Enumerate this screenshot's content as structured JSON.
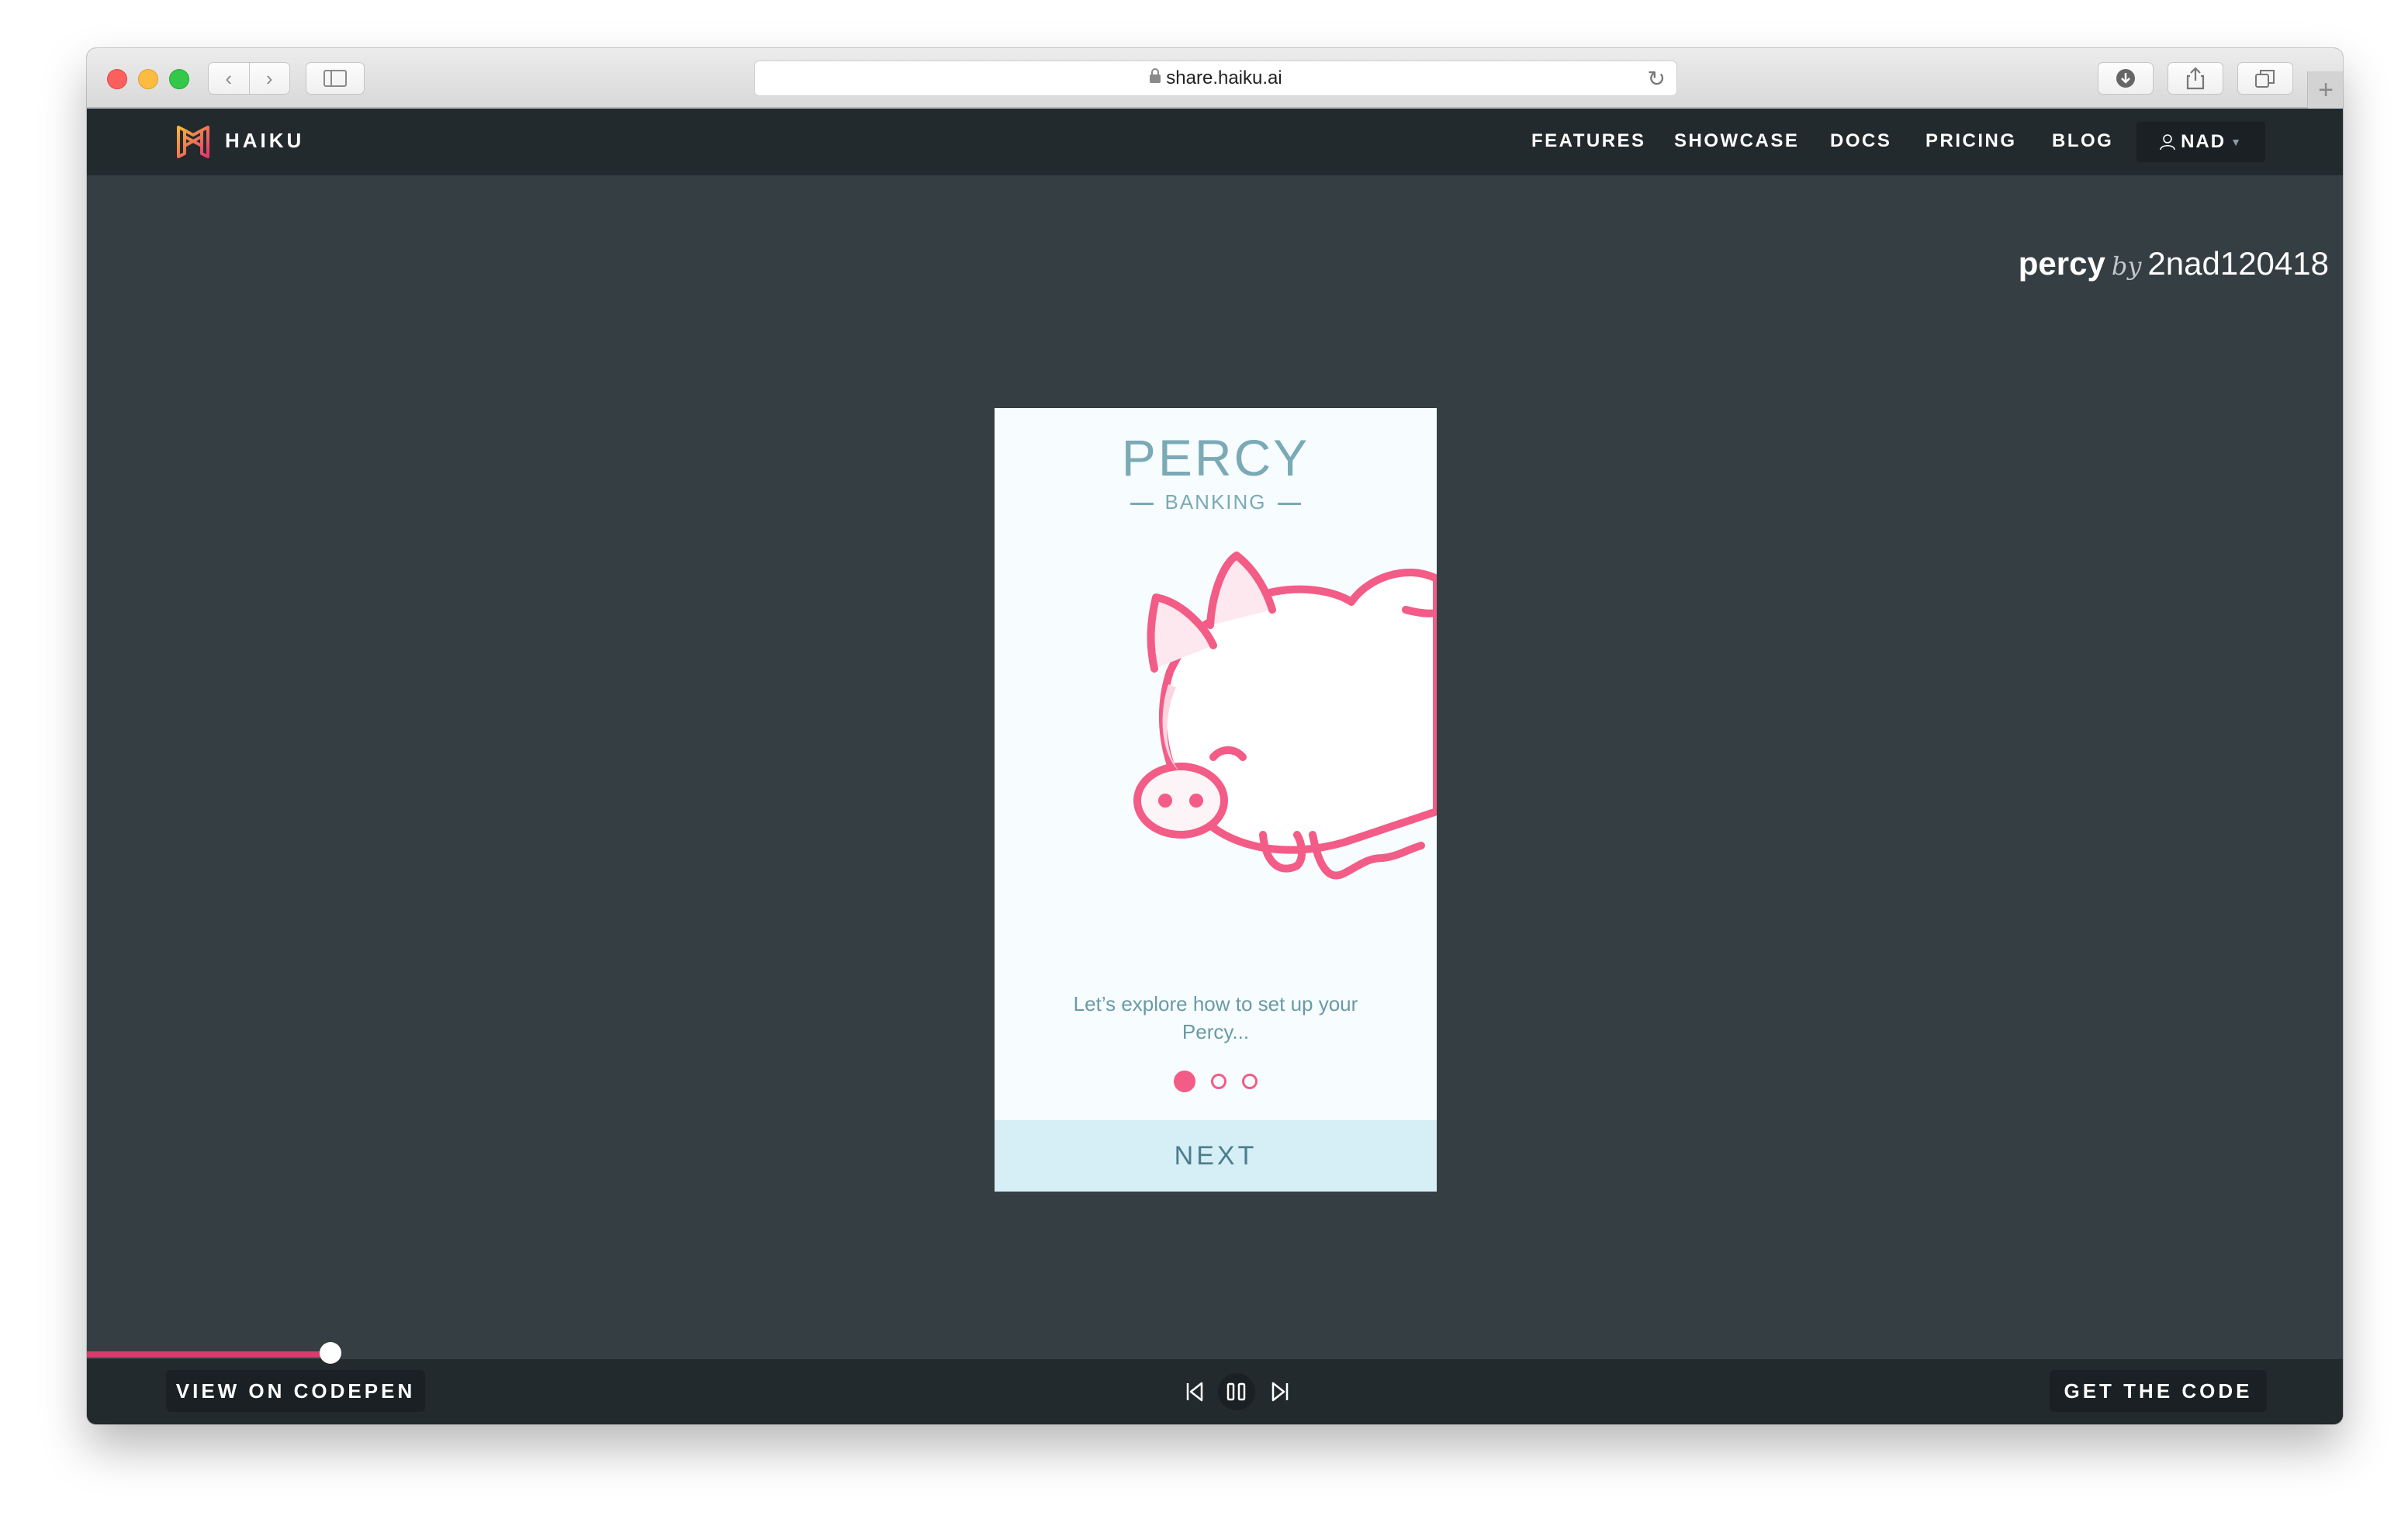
{
  "browser": {
    "url": "share.haiku.ai",
    "icons": {
      "back": "chevron-left-icon",
      "forward": "chevron-right-icon",
      "sidebar": "sidebar-icon",
      "lock": "lock-icon",
      "reload": "reload-icon",
      "download": "download-icon",
      "share": "share-icon",
      "tabs": "tabs-icon",
      "new_tab": "plus-icon"
    }
  },
  "header": {
    "brand": "HAIKU",
    "nav": [
      "FEATURES",
      "SHOWCASE",
      "DOCS",
      "PRICING",
      "BLOG"
    ],
    "user": "NAD"
  },
  "credit": {
    "project": "percy",
    "by": "by",
    "author": "2nad120418"
  },
  "phone": {
    "title": "PERCY",
    "subtitle": "BANKING",
    "text_line1": "Let’s explore how to set up your",
    "text_line2": "Percy...",
    "pages": 3,
    "active_page": 1,
    "next_label": "NEXT"
  },
  "player": {
    "progress": 0.075,
    "codepen_label": "VIEW ON CODEPEN",
    "code_label": "GET THE CODE"
  },
  "colors": {
    "accent": "#f25c86",
    "progress": "#d63c6e",
    "background": "#353e42",
    "header": "#232a2e"
  }
}
